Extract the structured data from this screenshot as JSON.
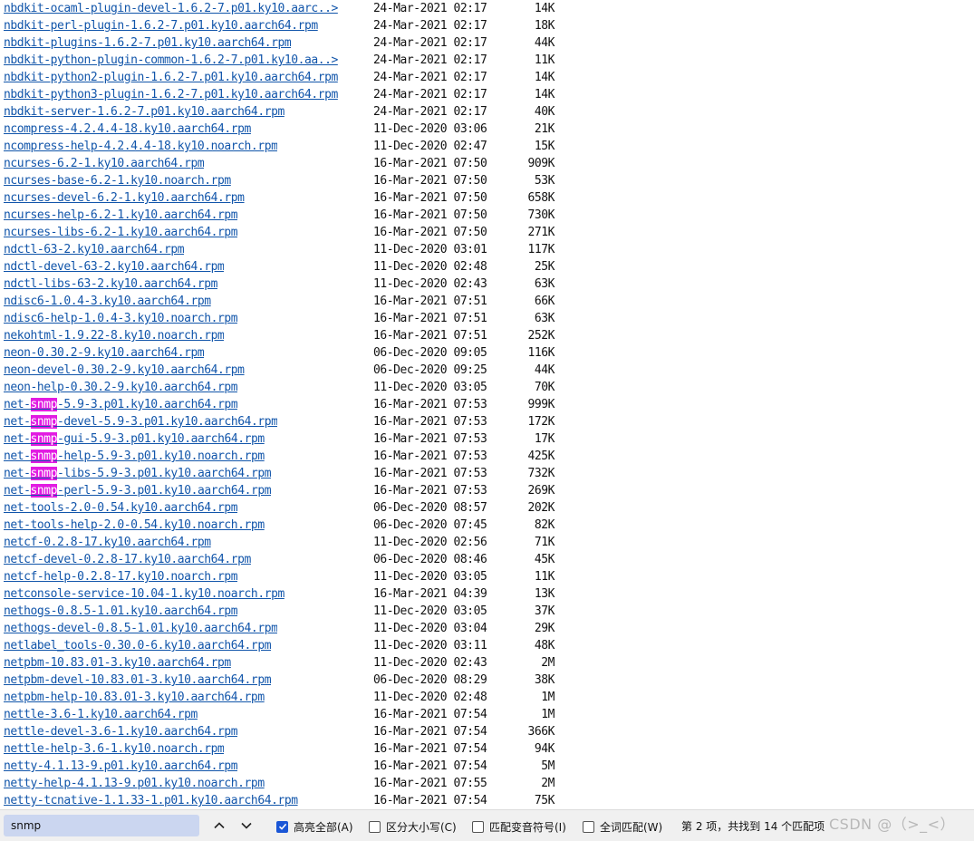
{
  "listing": [
    {
      "parts": [
        {
          "t": "nbdkit-ocaml-plugin-devel-1.6.2-7.p01.ky10.aarc..>"
        }
      ],
      "date": "24-Mar-2021 02:17",
      "size": "14K"
    },
    {
      "parts": [
        {
          "t": "nbdkit-perl-plugin-1.6.2-7.p01.ky10.aarch64.rpm"
        }
      ],
      "date": "24-Mar-2021 02:17",
      "size": "18K"
    },
    {
      "parts": [
        {
          "t": "nbdkit-plugins-1.6.2-7.p01.ky10.aarch64.rpm"
        }
      ],
      "date": "24-Mar-2021 02:17",
      "size": "44K"
    },
    {
      "parts": [
        {
          "t": "nbdkit-python-plugin-common-1.6.2-7.p01.ky10.aa..>"
        }
      ],
      "date": "24-Mar-2021 02:17",
      "size": "11K"
    },
    {
      "parts": [
        {
          "t": "nbdkit-python2-plugin-1.6.2-7.p01.ky10.aarch64.rpm"
        }
      ],
      "date": "24-Mar-2021 02:17",
      "size": "14K"
    },
    {
      "parts": [
        {
          "t": "nbdkit-python3-plugin-1.6.2-7.p01.ky10.aarch64.rpm"
        }
      ],
      "date": "24-Mar-2021 02:17",
      "size": "14K"
    },
    {
      "parts": [
        {
          "t": "nbdkit-server-1.6.2-7.p01.ky10.aarch64.rpm"
        }
      ],
      "date": "24-Mar-2021 02:17",
      "size": "40K"
    },
    {
      "parts": [
        {
          "t": "ncompress-4.2.4.4-18.ky10.aarch64.rpm"
        }
      ],
      "date": "11-Dec-2020 03:06",
      "size": "21K"
    },
    {
      "parts": [
        {
          "t": "ncompress-help-4.2.4.4-18.ky10.noarch.rpm"
        }
      ],
      "date": "11-Dec-2020 02:47",
      "size": "15K"
    },
    {
      "parts": [
        {
          "t": "ncurses-6.2-1.ky10.aarch64.rpm"
        }
      ],
      "date": "16-Mar-2021 07:50",
      "size": "909K"
    },
    {
      "parts": [
        {
          "t": "ncurses-base-6.2-1.ky10.noarch.rpm"
        }
      ],
      "date": "16-Mar-2021 07:50",
      "size": "53K"
    },
    {
      "parts": [
        {
          "t": "ncurses-devel-6.2-1.ky10.aarch64.rpm"
        }
      ],
      "date": "16-Mar-2021 07:50",
      "size": "658K"
    },
    {
      "parts": [
        {
          "t": "ncurses-help-6.2-1.ky10.aarch64.rpm"
        }
      ],
      "date": "16-Mar-2021 07:50",
      "size": "730K"
    },
    {
      "parts": [
        {
          "t": "ncurses-libs-6.2-1.ky10.aarch64.rpm"
        }
      ],
      "date": "16-Mar-2021 07:50",
      "size": "271K"
    },
    {
      "parts": [
        {
          "t": "ndctl-63-2.ky10.aarch64.rpm"
        }
      ],
      "date": "11-Dec-2020 03:01",
      "size": "117K"
    },
    {
      "parts": [
        {
          "t": "ndctl-devel-63-2.ky10.aarch64.rpm"
        }
      ],
      "date": "11-Dec-2020 02:48",
      "size": "25K"
    },
    {
      "parts": [
        {
          "t": "ndctl-libs-63-2.ky10.aarch64.rpm"
        }
      ],
      "date": "11-Dec-2020 02:43",
      "size": "63K"
    },
    {
      "parts": [
        {
          "t": "ndisc6-1.0.4-3.ky10.aarch64.rpm"
        }
      ],
      "date": "16-Mar-2021 07:51",
      "size": "66K"
    },
    {
      "parts": [
        {
          "t": "ndisc6-help-1.0.4-3.ky10.noarch.rpm"
        }
      ],
      "date": "16-Mar-2021 07:51",
      "size": "63K"
    },
    {
      "parts": [
        {
          "t": "nekohtml-1.9.22-8.ky10.noarch.rpm"
        }
      ],
      "date": "16-Mar-2021 07:51",
      "size": "252K"
    },
    {
      "parts": [
        {
          "t": "neon-0.30.2-9.ky10.aarch64.rpm"
        }
      ],
      "date": "06-Dec-2020 09:05",
      "size": "116K"
    },
    {
      "parts": [
        {
          "t": "neon-devel-0.30.2-9.ky10.aarch64.rpm"
        }
      ],
      "date": "06-Dec-2020 09:25",
      "size": "44K"
    },
    {
      "parts": [
        {
          "t": "neon-help-0.30.2-9.ky10.aarch64.rpm"
        }
      ],
      "date": "11-Dec-2020 03:05",
      "size": "70K"
    },
    {
      "parts": [
        {
          "t": "net-"
        },
        {
          "t": "snmp",
          "hl": true
        },
        {
          "t": "-5.9-3.p01.ky10.aarch64.rpm"
        }
      ],
      "date": "16-Mar-2021 07:53",
      "size": "999K"
    },
    {
      "parts": [
        {
          "t": "net-"
        },
        {
          "t": "snmp",
          "hl": true
        },
        {
          "t": "-devel-5.9-3.p01.ky10.aarch64.rpm"
        }
      ],
      "date": "16-Mar-2021 07:53",
      "size": "172K"
    },
    {
      "parts": [
        {
          "t": "net-"
        },
        {
          "t": "snmp",
          "hl": true
        },
        {
          "t": "-gui-5.9-3.p01.ky10.aarch64.rpm"
        }
      ],
      "date": "16-Mar-2021 07:53",
      "size": "17K"
    },
    {
      "parts": [
        {
          "t": "net-"
        },
        {
          "t": "snmp",
          "hl": true
        },
        {
          "t": "-help-5.9-3.p01.ky10.noarch.rpm"
        }
      ],
      "date": "16-Mar-2021 07:53",
      "size": "425K"
    },
    {
      "parts": [
        {
          "t": "net-"
        },
        {
          "t": "snmp",
          "hl": true
        },
        {
          "t": "-libs-5.9-3.p01.ky10.aarch64.rpm"
        }
      ],
      "date": "16-Mar-2021 07:53",
      "size": "732K"
    },
    {
      "parts": [
        {
          "t": "net-"
        },
        {
          "t": "snmp",
          "hl": true
        },
        {
          "t": "-perl-5.9-3.p01.ky10.aarch64.rpm"
        }
      ],
      "date": "16-Mar-2021 07:53",
      "size": "269K"
    },
    {
      "parts": [
        {
          "t": "net-tools-2.0-0.54.ky10.aarch64.rpm"
        }
      ],
      "date": "06-Dec-2020 08:57",
      "size": "202K"
    },
    {
      "parts": [
        {
          "t": "net-tools-help-2.0-0.54.ky10.noarch.rpm"
        }
      ],
      "date": "06-Dec-2020 07:45",
      "size": "82K"
    },
    {
      "parts": [
        {
          "t": "netcf-0.2.8-17.ky10.aarch64.rpm"
        }
      ],
      "date": "11-Dec-2020 02:56",
      "size": "71K"
    },
    {
      "parts": [
        {
          "t": "netcf-devel-0.2.8-17.ky10.aarch64.rpm"
        }
      ],
      "date": "06-Dec-2020 08:46",
      "size": "45K"
    },
    {
      "parts": [
        {
          "t": "netcf-help-0.2.8-17.ky10.noarch.rpm"
        }
      ],
      "date": "11-Dec-2020 03:05",
      "size": "11K"
    },
    {
      "parts": [
        {
          "t": "netconsole-service-10.04-1.ky10.noarch.rpm"
        }
      ],
      "date": "16-Mar-2021 04:39",
      "size": "13K"
    },
    {
      "parts": [
        {
          "t": "nethogs-0.8.5-1.01.ky10.aarch64.rpm"
        }
      ],
      "date": "11-Dec-2020 03:05",
      "size": "37K"
    },
    {
      "parts": [
        {
          "t": "nethogs-devel-0.8.5-1.01.ky10.aarch64.rpm"
        }
      ],
      "date": "11-Dec-2020 03:04",
      "size": "29K"
    },
    {
      "parts": [
        {
          "t": "netlabel_tools-0.30.0-6.ky10.aarch64.rpm"
        }
      ],
      "date": "11-Dec-2020 03:11",
      "size": "48K"
    },
    {
      "parts": [
        {
          "t": "netpbm-10.83.01-3.ky10.aarch64.rpm"
        }
      ],
      "date": "11-Dec-2020 02:43",
      "size": "2M"
    },
    {
      "parts": [
        {
          "t": "netpbm-devel-10.83.01-3.ky10.aarch64.rpm"
        }
      ],
      "date": "06-Dec-2020 08:29",
      "size": "38K"
    },
    {
      "parts": [
        {
          "t": "netpbm-help-10.83.01-3.ky10.aarch64.rpm"
        }
      ],
      "date": "11-Dec-2020 02:48",
      "size": "1M"
    },
    {
      "parts": [
        {
          "t": "nettle-3.6-1.ky10.aarch64.rpm"
        }
      ],
      "date": "16-Mar-2021 07:54",
      "size": "1M"
    },
    {
      "parts": [
        {
          "t": "nettle-devel-3.6-1.ky10.aarch64.rpm"
        }
      ],
      "date": "16-Mar-2021 07:54",
      "size": "366K"
    },
    {
      "parts": [
        {
          "t": "nettle-help-3.6-1.ky10.noarch.rpm"
        }
      ],
      "date": "16-Mar-2021 07:54",
      "size": "94K"
    },
    {
      "parts": [
        {
          "t": "netty-4.1.13-9.p01.ky10.aarch64.rpm"
        }
      ],
      "date": "16-Mar-2021 07:54",
      "size": "5M"
    },
    {
      "parts": [
        {
          "t": "netty-help-4.1.13-9.p01.ky10.noarch.rpm"
        }
      ],
      "date": "16-Mar-2021 07:55",
      "size": "2M"
    },
    {
      "parts": [
        {
          "t": "netty-tcnative-1.1.33-1.p01.ky10.aarch64.rpm"
        }
      ],
      "date": "16-Mar-2021 07:54",
      "size": "75K"
    }
  ],
  "findbar": {
    "query": "snmp",
    "prev_icon": "chevron-up-icon",
    "next_icon": "chevron-down-icon",
    "highlight_all": {
      "label": "高亮全部(A)",
      "checked": true
    },
    "match_case": {
      "label": "区分大小写(C)",
      "checked": false
    },
    "match_diacritics": {
      "label": "匹配变音符号(I)",
      "checked": false
    },
    "whole_words": {
      "label": "全词匹配(W)",
      "checked": false
    },
    "result": "第 2 项，共找到 14 个匹配项",
    "watermark": "CSDN @（>_<）"
  },
  "colors": {
    "link": "#1155aa",
    "highlight": "#e21be2",
    "checkbox_accent": "#1a56d6"
  }
}
